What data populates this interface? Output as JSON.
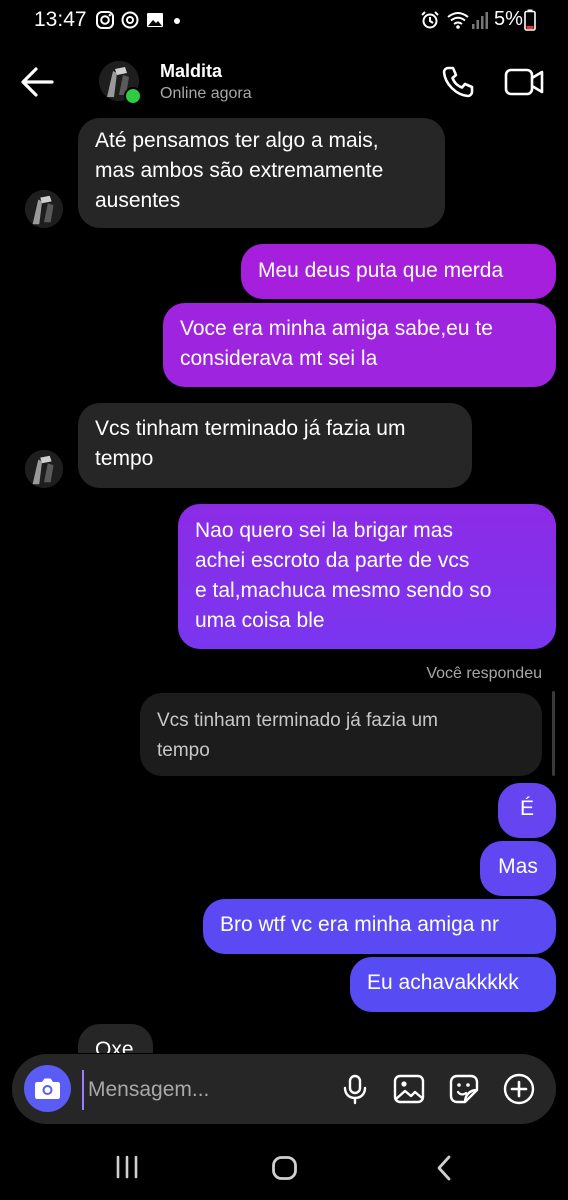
{
  "status_bar": {
    "time": "13:47",
    "battery": "5%",
    "left_icons": [
      "instagram-icon",
      "threads-icon",
      "gallery-icon",
      "dot-icon"
    ],
    "right_icons": [
      "alarm-icon",
      "wifi-icon",
      "signal-icon",
      "battery-icon"
    ]
  },
  "header": {
    "name": "Maldita",
    "status": "Online agora"
  },
  "messages": [
    {
      "dir": "in",
      "text": "Até pensamos ter algo a mais,\nmas ambos são extremamente\nausentes"
    },
    {
      "dir": "out",
      "text": "Meu deus puta que merda"
    },
    {
      "dir": "out",
      "text": "Voce era minha amiga sabe,eu te\nconsiderava mt sei la"
    },
    {
      "dir": "in",
      "text": "Vcs tinham terminado já fazia um\ntempo"
    },
    {
      "dir": "out",
      "text": "Nao quero sei la brigar mas\nachei escroto da parte de vcs\ne tal,machuca mesmo sendo so\numa coisa ble"
    },
    {
      "dir": "reply_label",
      "text": "Você respondeu"
    },
    {
      "dir": "quoted",
      "text": "Vcs tinham terminado já fazia um\ntempo"
    },
    {
      "dir": "out",
      "text": "É"
    },
    {
      "dir": "out",
      "text": "Mas"
    },
    {
      "dir": "out",
      "text": "Bro wtf vc era minha amiga nr"
    },
    {
      "dir": "out",
      "text": "Eu achavakkkkk"
    },
    {
      "dir": "in",
      "text": "Oxe"
    }
  ],
  "composer": {
    "placeholder": "Mensagem...",
    "icons": [
      "camera-icon",
      "microphone-icon",
      "image-icon",
      "sticker-icon",
      "plus-icon"
    ]
  },
  "colors": {
    "incoming_bubble": "#262626",
    "out_top": "#a020d8",
    "out_bottom": "#5b4ef5",
    "online": "#2ecc40",
    "camera_button": "#5b5bf5"
  }
}
